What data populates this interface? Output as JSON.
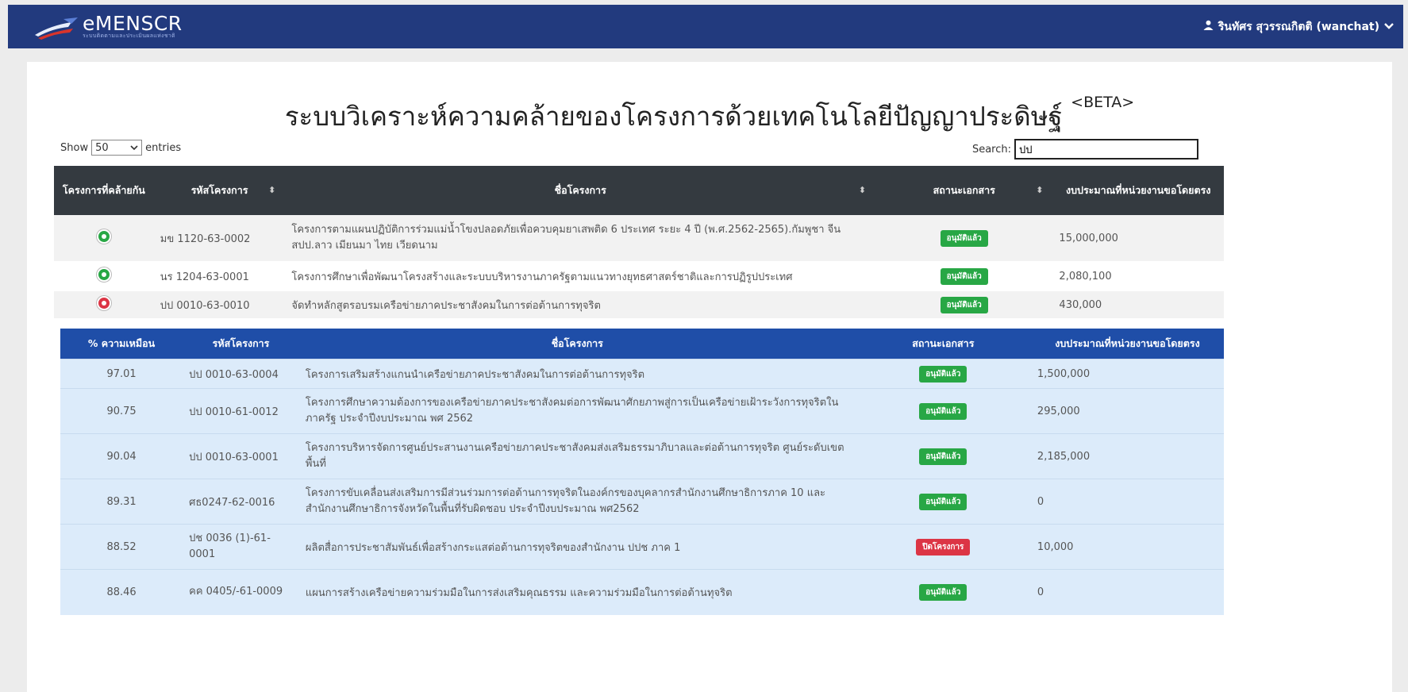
{
  "navbar": {
    "brand": "eMENSCR",
    "brand_sub": "ระบบติดตามและประเมินผลแห่งชาติ",
    "user": "รินทัศร สุวรรณกิตติ (wanchat)"
  },
  "page": {
    "title": "ระบบวิเคราะห์ความคล้ายของโครงการด้วยเทคโนโลยีปัญญาประดิษฐ์",
    "title_beta": "<BETA>"
  },
  "controls": {
    "show_label": "Show",
    "entries_value": "50",
    "entries_label": "entries",
    "search_label": "Search:",
    "search_value": "ปป"
  },
  "main_table": {
    "headers": [
      "โครงการที่คล้ายกัน",
      "รหัสโครงการ",
      "ชื่อโครงการ",
      "สถานะเอกสาร",
      "งบประมาณที่หน่วยงานขอโดยตรง"
    ],
    "rows": [
      {
        "toggle": "green",
        "code": "มข 1120-63-0002",
        "name": "โครงการตามแผนปฏิบัติการร่วมแม่น้ำโขงปลอดภัยเพื่อควบคุมยาเสพติด 6 ประเทศ ระยะ 4 ปี (พ.ศ.2562-2565).กัมพูชา จีน สปป.ลาว เมียนมา ไทย เวียดนาม",
        "status": "อนุมัติแล้ว",
        "status_color": "#28a745",
        "budget": "15,000,000"
      },
      {
        "toggle": "green",
        "code": "นร 1204-63-0001",
        "name": "โครงการศึกษาเพื่อพัฒนาโครงสร้างและระบบบริหารงานภาครัฐตามแนวทางยุทธศาสตร์ชาติและการปฏิรูปประเทศ",
        "status": "อนุมัติแล้ว",
        "status_color": "#28a745",
        "budget": "2,080,100"
      },
      {
        "toggle": "red",
        "code": "ปป 0010-63-0010",
        "name": "จัดทำหลักสูตรอบรมเครือข่ายภาคประชาสังคมในการต่อต้านการทุจริต",
        "status": "อนุมัติแล้ว",
        "status_color": "#28a745",
        "budget": "430,000"
      }
    ]
  },
  "similar_table": {
    "headers": [
      "% ความเหมือน",
      "รหัสโครงการ",
      "ชื่อโครงการ",
      "สถานะเอกสาร",
      "งบประมาณที่หน่วยงานขอโดยตรง"
    ],
    "rows": [
      {
        "percent": "97.01",
        "code": "ปป 0010-63-0004",
        "name": "โครงการเสริมสร้างแกนนำเครือข่ายภาคประชาสังคมในการต่อต้านการทุจริต",
        "status": "อนุมัติแล้ว",
        "status_color": "#28a745",
        "budget": "1,500,000"
      },
      {
        "percent": "90.75",
        "code": "ปป 0010-61-0012",
        "name": "โครงการศึกษาความต้องการของเครือข่ายภาคประชาสังคมต่อการพัฒนาศักยภาพสู่การเป็นเครือข่ายเฝ้าระวังการทุจริตในภาครัฐ ประจำปีงบประมาณ พศ 2562",
        "status": "อนุมัติแล้ว",
        "status_color": "#28a745",
        "budget": "295,000"
      },
      {
        "percent": "90.04",
        "code": "ปป 0010-63-0001",
        "name": "โครงการบริหารจัดการศูนย์ประสานงานเครือข่ายภาคประชาสังคมส่งเสริมธรรมาภิบาลและต่อต้านการทุจริต ศูนย์ระดับเขตพื้นที่",
        "status": "อนุมัติแล้ว",
        "status_color": "#28a745",
        "budget": "2,185,000"
      },
      {
        "percent": "89.31",
        "code": "ศธ0247-62-0016",
        "name": "โครงการขับเคลื่อนส่งเสริมการมีส่วนร่วมการต่อต้านการทุจริตในองค์กรของบุคลากรสำนักงานศึกษาธิการภาค 10 และสำนักงานศึกษาธิการจังหวัดในพื้นที่รับผิดชอบ ประจำปีงบประมาณ พศ2562",
        "status": "อนุมัติแล้ว",
        "status_color": "#28a745",
        "budget": "0"
      },
      {
        "percent": "88.52",
        "code": "ปช 0036 (1)-61-0001",
        "name": "ผลิตสื่อการประชาสัมพันธ์เพื่อสร้างกระแสต่อต้านการทุจริตของสำนักงาน ปปช ภาค 1",
        "status": "ปิดโครงการ",
        "status_color": "#dc3545",
        "budget": "10,000"
      },
      {
        "percent": "88.46",
        "code": "คค 0405/-61-0009",
        "name": "แผนการสร้างเครือข่ายความร่วมมือในการส่งเสริมคุณธรรม และความร่วมมือในการต่อต้านทุจริต",
        "status": "อนุมัติแล้ว",
        "status_color": "#28a745",
        "budget": "0"
      }
    ]
  }
}
